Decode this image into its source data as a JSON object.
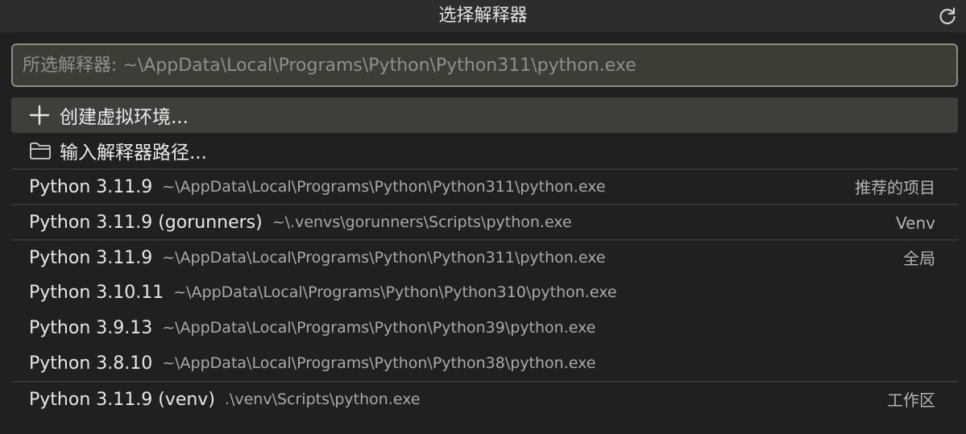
{
  "title": "选择解释器",
  "refresh_icon": "refresh-icon",
  "search": {
    "placeholder": "所选解释器: ~\\AppData\\Local\\Programs\\Python\\Python311\\python.exe",
    "value": ""
  },
  "actions": [
    {
      "icon": "plus-icon",
      "label": "创建虚拟环境..."
    },
    {
      "icon": "folder-icon",
      "label": "输入解释器路径..."
    }
  ],
  "interpreters": [
    {
      "name": "Python 3.11.9",
      "path": "~\\AppData\\Local\\Programs\\Python\\Python311\\python.exe",
      "tag": "推荐的项目"
    },
    {
      "name": "Python 3.11.9 (gorunners)",
      "path": "~\\.venvs\\gorunners\\Scripts\\python.exe",
      "tag": "Venv"
    },
    {
      "name": "Python 3.11.9",
      "path": "~\\AppData\\Local\\Programs\\Python\\Python311\\python.exe",
      "tag": "全局"
    },
    {
      "name": "Python 3.10.11",
      "path": "~\\AppData\\Local\\Programs\\Python\\Python310\\python.exe",
      "tag": ""
    },
    {
      "name": "Python 3.9.13",
      "path": "~\\AppData\\Local\\Programs\\Python\\Python39\\python.exe",
      "tag": ""
    },
    {
      "name": "Python 3.8.10",
      "path": "~\\AppData\\Local\\Programs\\Python\\Python38\\python.exe",
      "tag": ""
    },
    {
      "name": "Python 3.11.9 (venv)",
      "path": ".\\venv\\Scripts\\python.exe",
      "tag": "工作区"
    }
  ],
  "colors": {
    "background": "#202020",
    "title_bar": "#2d2d2d",
    "input_border": "#8c8e7e",
    "input_bg": "#3c3d34",
    "active_row": "#3d3f3a",
    "separator": "#363636"
  }
}
